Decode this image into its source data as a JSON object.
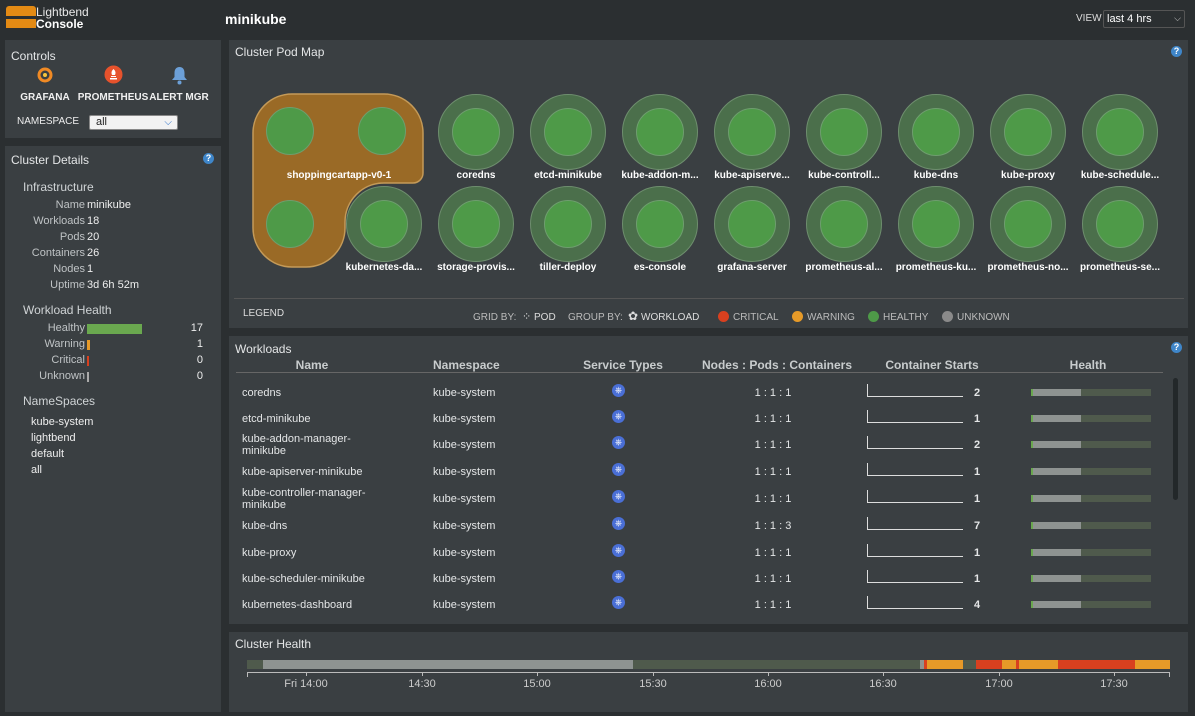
{
  "app": {
    "logo_line1": "Lightbend",
    "logo_line2": "Console",
    "cluster_name": "minikube"
  },
  "view": {
    "label": "VIEW",
    "selected": "last 4 hrs"
  },
  "controls": {
    "title": "Controls",
    "links": [
      {
        "label": "GRAFANA",
        "icon": "grafana-icon"
      },
      {
        "label": "PROMETHEUS",
        "icon": "prometheus-icon"
      },
      {
        "label": "ALERT MGR",
        "icon": "bell-icon"
      }
    ],
    "namespace_label": "NAMESPACE",
    "namespace_value": "all"
  },
  "cluster_details": {
    "title": "Cluster Details",
    "infrastructure_title": "Infrastructure",
    "rows": [
      {
        "label": "Name",
        "value": "minikube"
      },
      {
        "label": "Workloads",
        "value": "18"
      },
      {
        "label": "Pods",
        "value": "20"
      },
      {
        "label": "Containers",
        "value": "26"
      },
      {
        "label": "Nodes",
        "value": "1"
      },
      {
        "label": "Uptime",
        "value": "3d 6h 52m"
      }
    ],
    "workload_health_title": "Workload Health",
    "health": [
      {
        "label": "Healthy",
        "value": "17",
        "fraction": 0.94,
        "color": "#6aa84f"
      },
      {
        "label": "Warning",
        "value": "1",
        "fraction": 0.06,
        "color": "#e69a28"
      },
      {
        "label": "Critical",
        "value": "0",
        "fraction": 0.0,
        "color": "#d8401f"
      },
      {
        "label": "Unknown",
        "value": "0",
        "fraction": 0.0,
        "color": "#aaaaaa"
      }
    ],
    "namespaces_title": "NameSpaces",
    "namespaces": [
      "kube-system",
      "lightbend",
      "default",
      "all"
    ]
  },
  "pod_map": {
    "title": "Cluster Pod Map",
    "pods_row1": [
      "coredns",
      "etcd-minikube",
      "kube-addon-m...",
      "kube-apiserve...",
      "kube-controll...",
      "kube-dns",
      "kube-proxy",
      "kube-schedule..."
    ],
    "pods_row2": [
      "kubernetes-da...",
      "storage-provis...",
      "tiller-deploy",
      "es-console",
      "grafana-server",
      "prometheus-al...",
      "prometheus-ku...",
      "prometheus-no...",
      "prometheus-se..."
    ],
    "group_label": "shoppingcartapp-v0-1",
    "legend": {
      "title": "LEGEND",
      "grid_by_label": "GRID BY:",
      "grid_by_value": "POD",
      "group_by_label": "GROUP BY:",
      "group_by_value": "WORKLOAD",
      "states": [
        {
          "label": "CRITICAL",
          "color": "#d8401f"
        },
        {
          "label": "WARNING",
          "color": "#e69a28"
        },
        {
          "label": "HEALTHY",
          "color": "#4e9a48"
        },
        {
          "label": "UNKNOWN",
          "color": "#8a8a8a"
        }
      ]
    }
  },
  "workloads": {
    "title": "Workloads",
    "columns": [
      "Name",
      "Namespace",
      "Service Types",
      "Nodes : Pods : Containers",
      "Container Starts",
      "Health"
    ],
    "rows": [
      {
        "name1": "coredns",
        "name2": "",
        "namespace": "kube-system",
        "npc": "1 : 1 : 1",
        "starts": "2",
        "health": 0.42
      },
      {
        "name1": "etcd-minikube",
        "name2": "",
        "namespace": "kube-system",
        "npc": "1 : 1 : 1",
        "starts": "1",
        "health": 0.42
      },
      {
        "name1": "kube-addon-manager-",
        "name2": "minikube",
        "namespace": "kube-system",
        "npc": "1 : 1 : 1",
        "starts": "2",
        "health": 0.42
      },
      {
        "name1": "kube-apiserver-minikube",
        "name2": "",
        "namespace": "kube-system",
        "npc": "1 : 1 : 1",
        "starts": "1",
        "health": 0.42
      },
      {
        "name1": "kube-controller-manager-",
        "name2": "minikube",
        "namespace": "kube-system",
        "npc": "1 : 1 : 1",
        "starts": "1",
        "health": 0.42
      },
      {
        "name1": "kube-dns",
        "name2": "",
        "namespace": "kube-system",
        "npc": "1 : 1 : 3",
        "starts": "7",
        "health": 0.42
      },
      {
        "name1": "kube-proxy",
        "name2": "",
        "namespace": "kube-system",
        "npc": "1 : 1 : 1",
        "starts": "1",
        "health": 0.42
      },
      {
        "name1": "kube-scheduler-minikube",
        "name2": "",
        "namespace": "kube-system",
        "npc": "1 : 1 : 1",
        "starts": "1",
        "health": 0.42
      },
      {
        "name1": "kubernetes-dashboard",
        "name2": "",
        "namespace": "kube-system",
        "npc": "1 : 1 : 1",
        "starts": "4",
        "health": 0.42
      }
    ]
  },
  "cluster_health": {
    "title": "Cluster Health",
    "ticks": [
      "Fri 14:00",
      "14:30",
      "15:00",
      "15:30",
      "16:00",
      "16:30",
      "17:00",
      "17:30"
    ],
    "timeline_colors": {
      "unknown": "#8e9391",
      "healthy": "#4f5a4c",
      "warning": "#e69a28",
      "critical": "#d8401f"
    }
  }
}
